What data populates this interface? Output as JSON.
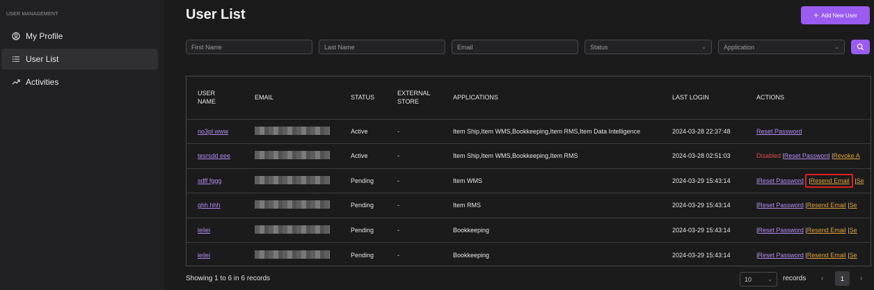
{
  "sidebar": {
    "section_title": "USER MANAGEMENT",
    "items": [
      {
        "label": "My Profile",
        "icon": "user-circle-icon",
        "active": false
      },
      {
        "label": "User List",
        "icon": "list-icon",
        "active": true
      },
      {
        "label": "Activities",
        "icon": "trend-icon",
        "active": false
      }
    ]
  },
  "header": {
    "title": "User List",
    "add_button": "Add New User"
  },
  "filters": {
    "first_name_placeholder": "First Name",
    "last_name_placeholder": "Last Name",
    "email_placeholder": "Email",
    "status_placeholder": "Status",
    "application_placeholder": "Application"
  },
  "table": {
    "headers": {
      "user_name_1": "USER",
      "user_name_2": "NAME",
      "email": "EMAIL",
      "status": "STATUS",
      "external_1": "EXTERNAL",
      "external_2": "STORE",
      "applications": "APPLICATIONS",
      "last_login": "LAST LOGIN",
      "actions": "ACTIONS"
    },
    "rows": [
      {
        "user": "no3pl www",
        "status": "Active",
        "store": "-",
        "apps": "Item Ship,Item WMS,Bookkeeping,Item RMS,Item Data Intelligence",
        "last_login": "2024-03-28 22:37:48"
      },
      {
        "user": "tesrsdd eee",
        "status": "Active",
        "store": "-",
        "apps": "Item Ship,Item WMS,Bookkeeping,Item RMS",
        "last_login": "2024-03-28 02:51:03"
      },
      {
        "user": "sdff fggg",
        "status": "Pending",
        "store": "-",
        "apps": "Item WMS",
        "last_login": "2024-03-29 15:43:14"
      },
      {
        "user": "ghh hhh",
        "status": "Pending",
        "store": "-",
        "apps": "Item RMS",
        "last_login": "2024-03-29 15:43:14"
      },
      {
        "user": "leilei",
        "status": "Pending",
        "store": "-",
        "apps": "Bookkeeping",
        "last_login": "2024-03-29 15:43:14"
      },
      {
        "user": "leilei",
        "status": "Pending",
        "store": "-",
        "apps": "Bookkeeping",
        "last_login": "2024-03-29 15:43:14"
      }
    ],
    "actions": {
      "reset": "Reset Password",
      "resend": "Resend Email",
      "disabled": "Disabled",
      "revoke": "Revoke A",
      "separator": "|",
      "se": "Se"
    }
  },
  "footer": {
    "showing": "Showing 1 to 6 in 6 records",
    "page_size": "10",
    "records_label": "records",
    "prev": "‹",
    "next": "›",
    "current_page": "1"
  },
  "colors": {
    "accent": "#9a5cf0",
    "link": "#b38cf2",
    "warning_link": "#e0a23a",
    "danger": "#e04b4b",
    "highlight_box": "#e02020"
  }
}
